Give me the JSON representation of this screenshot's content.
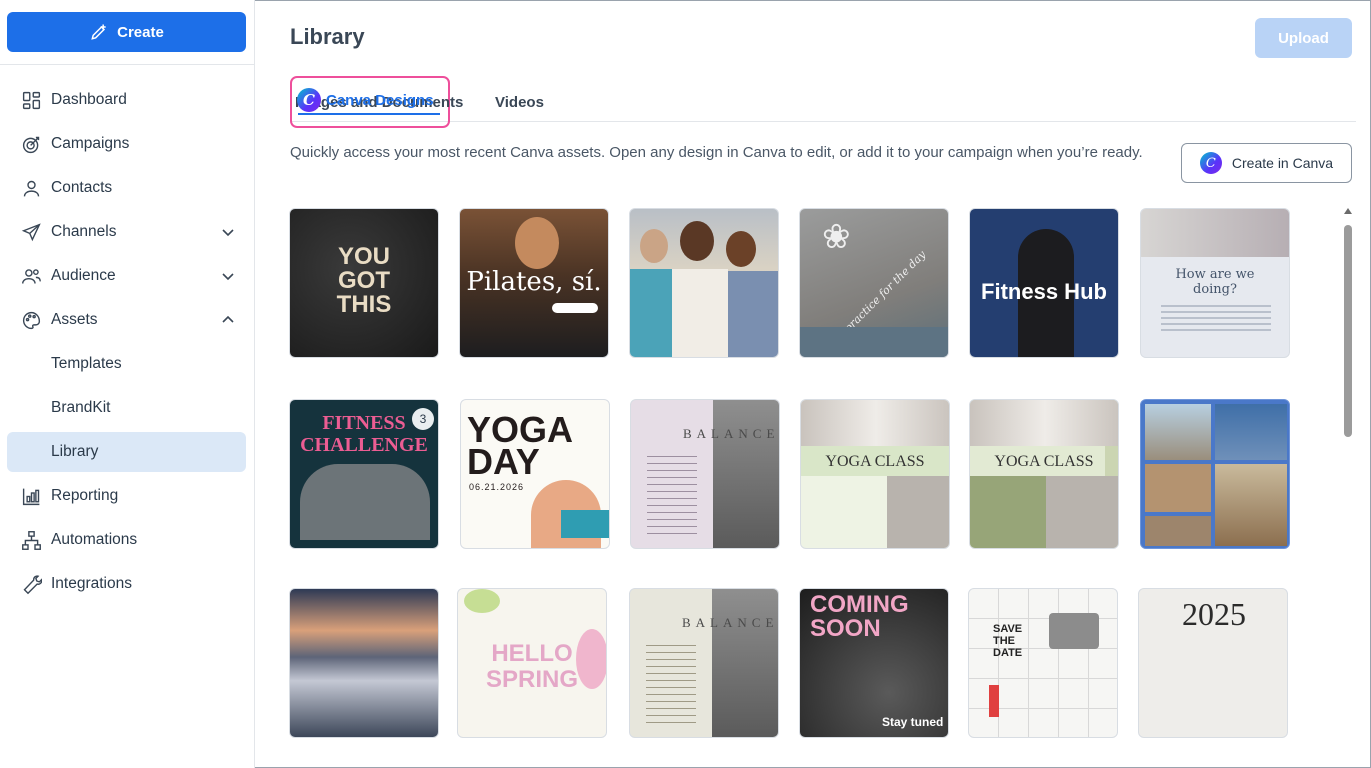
{
  "sidebar": {
    "create_label": "Create",
    "items": [
      {
        "label": "Dashboard"
      },
      {
        "label": "Campaigns"
      },
      {
        "label": "Contacts"
      },
      {
        "label": "Channels"
      },
      {
        "label": "Audience"
      },
      {
        "label": "Assets"
      },
      {
        "label": "Templates"
      },
      {
        "label": "BrandKit"
      },
      {
        "label": "Library"
      },
      {
        "label": "Reporting"
      },
      {
        "label": "Automations"
      },
      {
        "label": "Integrations"
      }
    ]
  },
  "header": {
    "title": "Library",
    "upload_label": "Upload"
  },
  "tabs": [
    {
      "label": "Images and Documents"
    },
    {
      "label": "Videos"
    },
    {
      "label": "Canva Designs"
    }
  ],
  "intro_text": "Quickly access your most recent Canva assets. Open any design in Canva to edit, or add it to your campaign when you’re ready.",
  "create_in_canva_label": "Create in Canva",
  "designs": [
    {
      "text": "YOU GOT THIS"
    },
    {
      "text": "Pilates, sí."
    },
    {
      "text": ""
    },
    {
      "text": "practice for the day"
    },
    {
      "text": "Fitness Hub"
    },
    {
      "text": "How are we doing?"
    },
    {
      "text": "FITNESS CHALLENGE"
    },
    {
      "text": "YOGA DAY",
      "sub": "06.21.2026"
    },
    {
      "text": "BALANCE"
    },
    {
      "text": "YOGA CLASS"
    },
    {
      "text": "YOGA CLASS"
    },
    {
      "text": ""
    },
    {
      "text": ""
    },
    {
      "text": "HELLO SPRING"
    },
    {
      "text": "BALANCE"
    },
    {
      "text": "COMING SOON",
      "sub": "Stay tuned"
    },
    {
      "text": "SAVE THE DATE"
    },
    {
      "text": "2025"
    }
  ]
}
